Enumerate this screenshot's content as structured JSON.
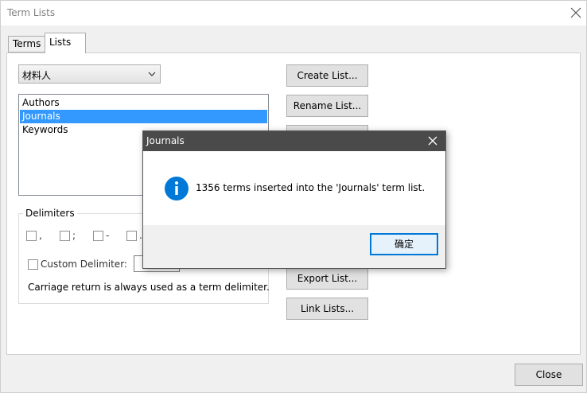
{
  "window": {
    "title": "Term Lists"
  },
  "tabs": [
    {
      "label": "Terms",
      "active": false
    },
    {
      "label": "Lists",
      "active": true
    }
  ],
  "library_combo": {
    "selected": "材料人"
  },
  "term_lists": {
    "items": [
      "Authors",
      "Journals",
      "Keywords"
    ],
    "selected_index": 1
  },
  "delimiters": {
    "label": "Delimiters",
    "options": [
      {
        "label": ",",
        "checked": false
      },
      {
        "label": ";",
        "checked": false
      },
      {
        "label": "-",
        "checked": false
      },
      {
        "label": ".",
        "checked": false
      }
    ],
    "custom_label": "Custom Delimiter:",
    "custom_value": "",
    "note": "Carriage return is always used as a term delimiter."
  },
  "side_buttons": {
    "create": "Create List...",
    "rename": "Rename List...",
    "export": "Export List...",
    "link": "Link Lists..."
  },
  "footer": {
    "close_label": "Close"
  },
  "dialog": {
    "title": "Journals",
    "message": "1356 terms inserted into the 'Journals' term list.",
    "ok_label": "确定",
    "icon": "info-icon",
    "icon_color": "#0078d7"
  }
}
